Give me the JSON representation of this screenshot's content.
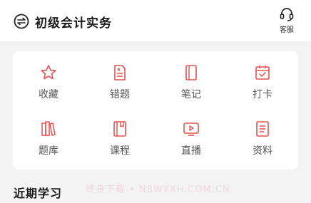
{
  "header": {
    "switch_icon": "switch-course-icon",
    "course_title": "初级会计实务",
    "service_icon": "headset-icon",
    "service_label": "客服"
  },
  "grid": {
    "items": [
      {
        "label": "收藏",
        "icon": "star-icon"
      },
      {
        "label": "错题",
        "icon": "wrong-question-icon"
      },
      {
        "label": "笔记",
        "icon": "notebook-icon"
      },
      {
        "label": "打卡",
        "icon": "calendar-check-icon"
      },
      {
        "label": "题库",
        "icon": "books-icon"
      },
      {
        "label": "课程",
        "icon": "course-icon"
      },
      {
        "label": "直播",
        "icon": "live-play-icon"
      },
      {
        "label": "资料",
        "icon": "document-icon"
      }
    ]
  },
  "recent": {
    "title": "近期学习"
  },
  "watermark": {
    "text": "终身下载 • N8WYXH.COM.CN"
  },
  "colors": {
    "accent": "#e5504f",
    "background": "#f3f3f3"
  }
}
